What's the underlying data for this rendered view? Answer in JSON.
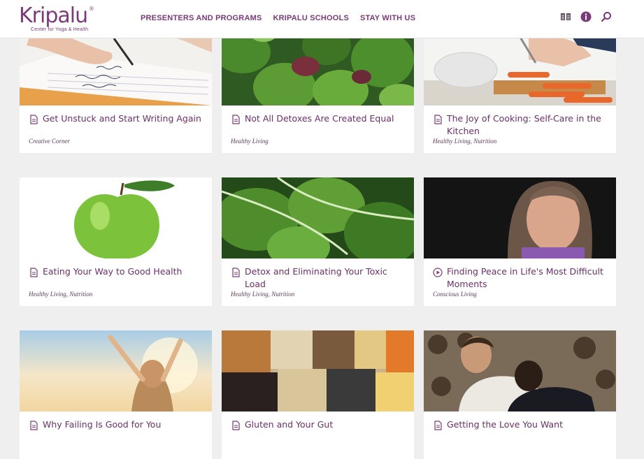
{
  "header": {
    "logo": {
      "wordmark": "Kripalu",
      "registered": "®",
      "tagline": "Center for Yoga & Health"
    },
    "nav": [
      "PRESENTERS AND PROGRAMS",
      "KRIPALU SCHOOLS",
      "STAY WITH US"
    ],
    "icons": [
      "book-icon",
      "info-icon",
      "search-icon"
    ]
  },
  "cards": [
    {
      "title": "Get Unstuck and Start Writing Again",
      "category": "Creative Corner",
      "icon": "document-icon",
      "image": "hand writing in notebook"
    },
    {
      "title": "Not All Detoxes Are Created Equal",
      "category": "Healthy Living",
      "icon": "document-icon",
      "image": "leafy greens"
    },
    {
      "title": "The Joy of Cooking: Self-Care in the Kitchen",
      "category": "Healthy Living, Nutrition",
      "icon": "document-icon",
      "image": "chopping carrots"
    },
    {
      "title": "Eating Your Way to Good Health",
      "category": "Healthy Living, Nutrition",
      "icon": "document-icon",
      "image": "green apple"
    },
    {
      "title": "Detox and Eliminating Your Toxic Load",
      "category": "Healthy Living, Nutrition",
      "icon": "document-icon",
      "image": "chard leaves"
    },
    {
      "title": "Finding Peace in Life's Most Difficult Moments",
      "category": "Conscious Living",
      "icon": "play-icon",
      "image": "woman speaking"
    },
    {
      "title": "Why Failing Is Good for You",
      "category": "",
      "icon": "document-icon",
      "image": "woman with raised arms in sunlight"
    },
    {
      "title": "Gluten and Your Gut",
      "category": "",
      "icon": "document-icon",
      "image": "assorted grains and seeds"
    },
    {
      "title": "Getting the Love You Want",
      "category": "",
      "icon": "document-icon",
      "image": "couple on sofa"
    }
  ],
  "colors": {
    "brand": "#7b3a79",
    "title": "#6c2f6a",
    "background": "#efefef"
  }
}
